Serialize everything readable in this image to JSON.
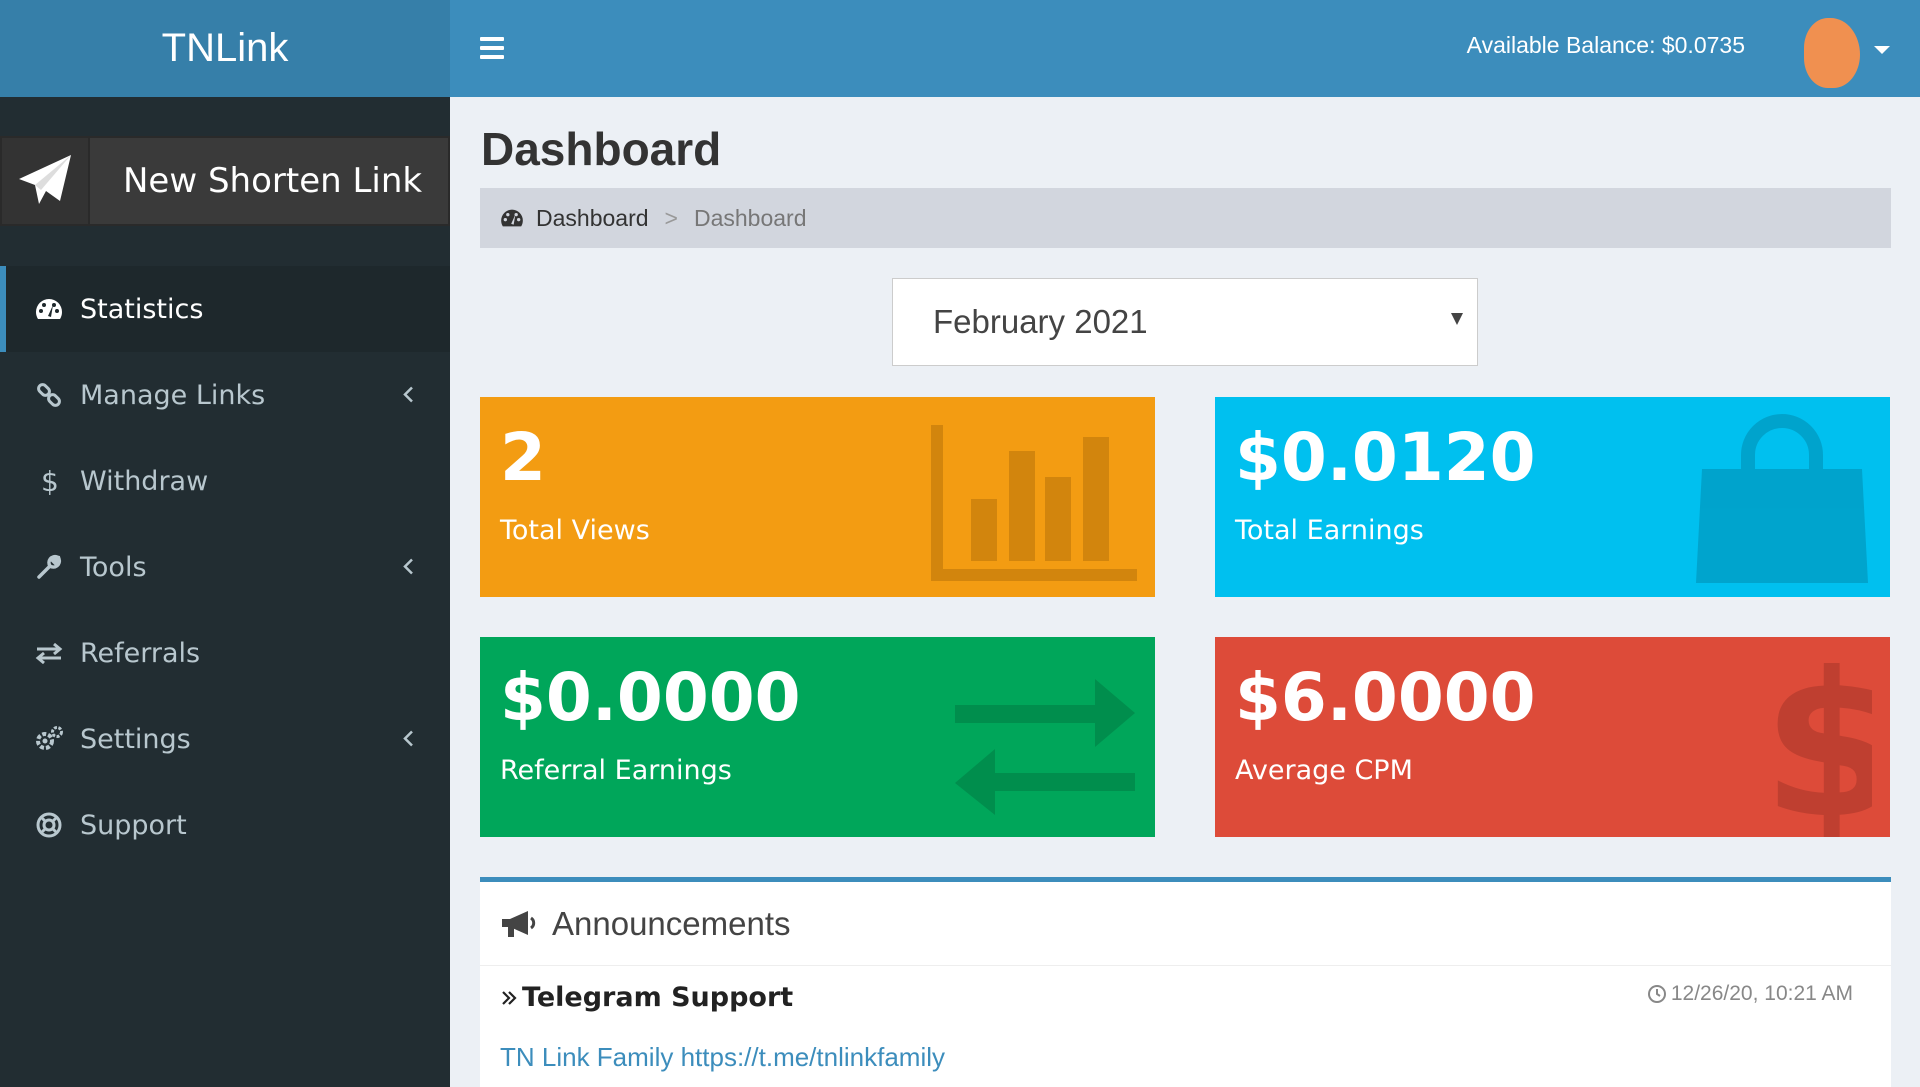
{
  "brand": "TNLink",
  "sidebar": {
    "new_link_label": "New Shorten Link",
    "items": [
      {
        "label": "Statistics",
        "icon": "dashboard-icon",
        "active": true,
        "has_children": false
      },
      {
        "label": "Manage Links",
        "icon": "link-icon",
        "active": false,
        "has_children": true
      },
      {
        "label": "Withdraw",
        "icon": "dollar-icon",
        "active": false,
        "has_children": false
      },
      {
        "label": "Tools",
        "icon": "wrench-icon",
        "active": false,
        "has_children": true
      },
      {
        "label": "Referrals",
        "icon": "exchange-icon",
        "active": false,
        "has_children": false
      },
      {
        "label": "Settings",
        "icon": "gears-icon",
        "active": false,
        "has_children": true
      },
      {
        "label": "Support",
        "icon": "life-ring-icon",
        "active": false,
        "has_children": false
      }
    ]
  },
  "header": {
    "balance": "Available Balance: $0.0735"
  },
  "page": {
    "title": "Dashboard",
    "breadcrumb": [
      "Dashboard",
      "Dashboard"
    ]
  },
  "filter": {
    "month": "February 2021"
  },
  "stats": {
    "views": {
      "value": "2",
      "label": "Total Views"
    },
    "earnings": {
      "value": "$0.0120",
      "label": "Total Earnings"
    },
    "referral": {
      "value": "$0.0000",
      "label": "Referral Earnings"
    },
    "cpm": {
      "value": "$6.0000",
      "label": "Average CPM"
    }
  },
  "announcements": {
    "title": "Announcements",
    "items": [
      {
        "title": "Telegram Support",
        "date": "12/26/20, 10:21 AM",
        "text": "TN Link Family https://t.me/tnlinkfamily"
      }
    ]
  },
  "colors": {
    "header": "#3c8dbc",
    "sidebar": "#222d32",
    "views": "#f39c12",
    "earnings": "#00c0ef",
    "referral": "#00a65a",
    "cpm": "#dd4b39"
  }
}
